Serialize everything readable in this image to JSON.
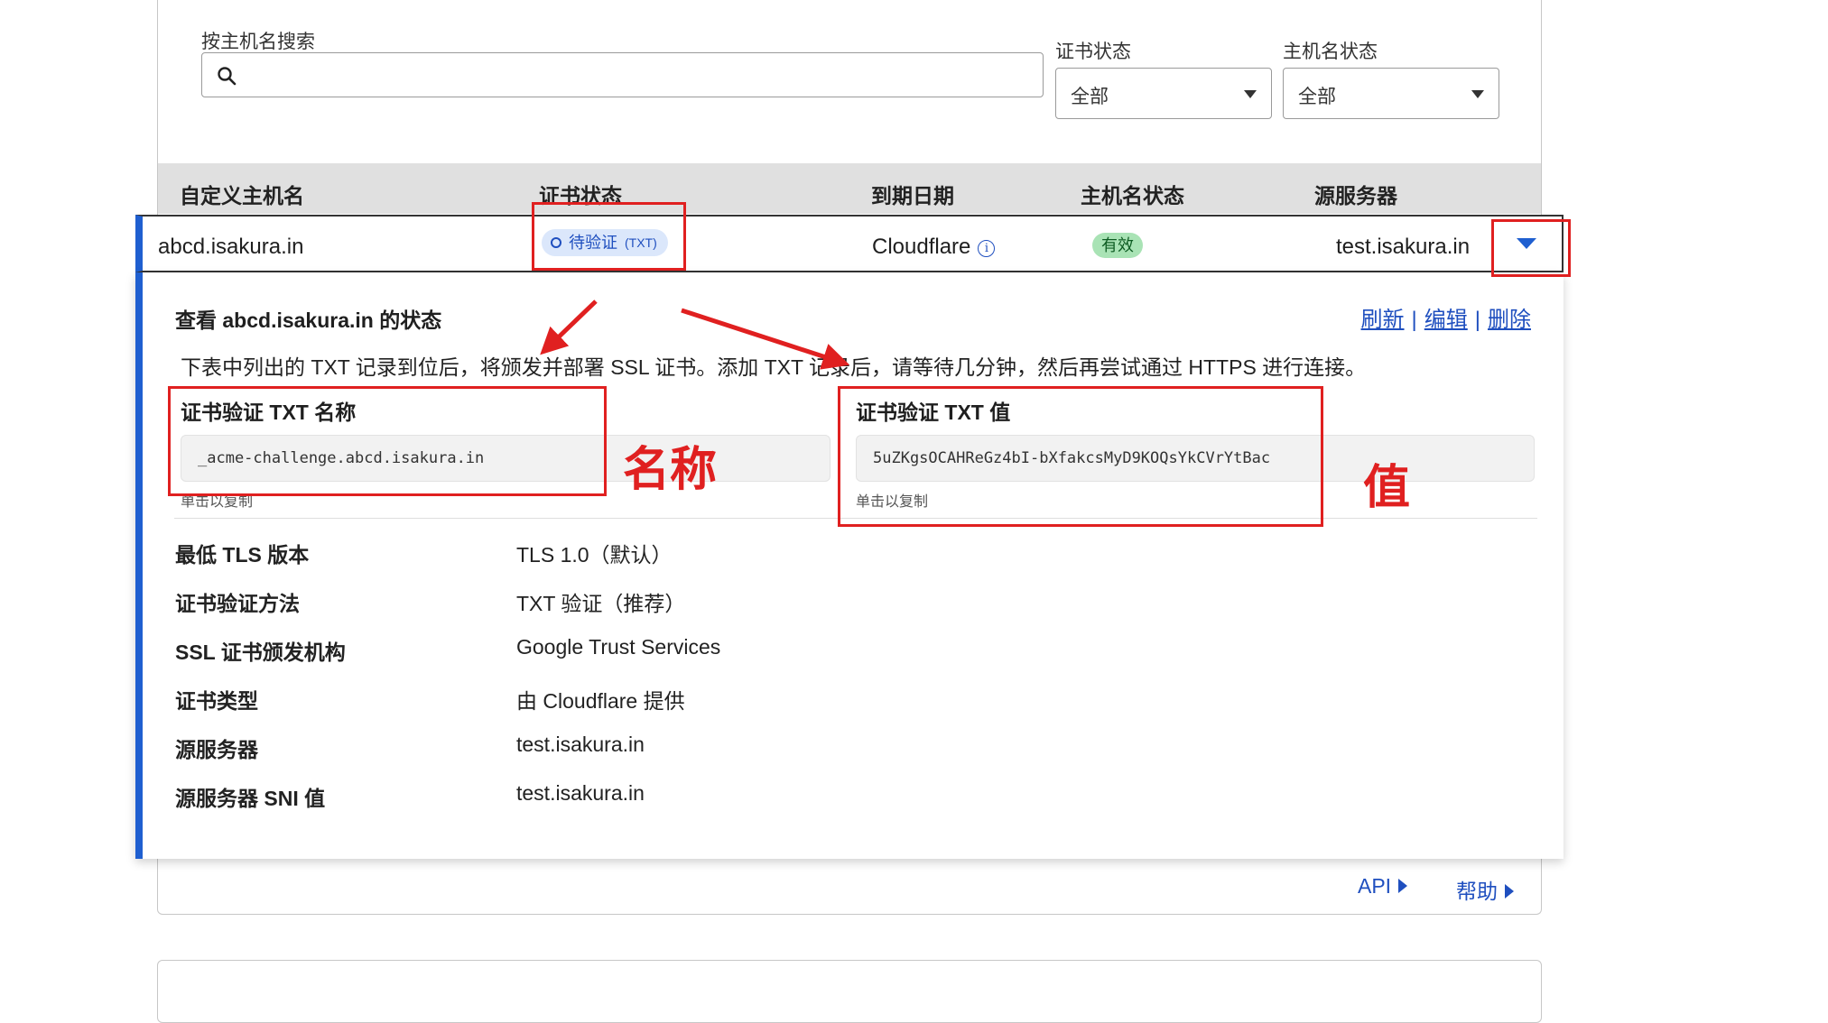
{
  "filters": {
    "search_label": "按主机名搜索",
    "search_value": "",
    "cert_status_label": "证书状态",
    "cert_status_value": "全部",
    "host_status_label": "主机名状态",
    "host_status_value": "全部"
  },
  "table": {
    "headers": [
      "自定义主机名",
      "证书状态",
      "到期日期",
      "主机名状态",
      "源服务器"
    ],
    "row": {
      "hostname": "abcd.isakura.in",
      "cert_status": "待验证",
      "cert_status_sub": "(TXT)",
      "expiry": "Cloudflare",
      "host_status": "有效",
      "origin": "test.isakura.in"
    }
  },
  "detail": {
    "title": "查看 abcd.isakura.in 的状态",
    "links": [
      "刷新",
      "编辑",
      "删除"
    ],
    "description": "下表中列出的 TXT 记录到位后，将颁发并部署 SSL 证书。添加 TXT 记录后，请等待几分钟，然后再尝试通过 HTTPS 进行连接。",
    "txt_name_label": "证书验证 TXT 名称",
    "txt_name_value": "_acme-challenge.abcd.isakura.in",
    "txt_value_label": "证书验证 TXT 值",
    "txt_value_value": "5uZKgsOCAHReGz4bI-bXfakcsMyD9KOQsYkCVrYtBac",
    "copy_hint": "单击以复制",
    "properties": [
      {
        "key": "最低 TLS 版本",
        "value": "TLS 1.0（默认）"
      },
      {
        "key": "证书验证方法",
        "value": "TXT 验证（推荐）"
      },
      {
        "key": "SSL 证书颁发机构",
        "value": "Google Trust Services"
      },
      {
        "key": "证书类型",
        "value": "由 Cloudflare 提供"
      },
      {
        "key": "源服务器",
        "value": "test.isakura.in"
      },
      {
        "key": "源服务器 SNI 值",
        "value": "test.isakura.in"
      }
    ]
  },
  "footer": {
    "api_label": "API",
    "help_label": "帮助"
  },
  "annotations": {
    "name_label": "名称",
    "value_label": "值"
  },
  "colors": {
    "accent": "#1f5fd0",
    "annotation": "#e02020",
    "header_bg": "#e0e0e0"
  },
  "icons": [
    "search-icon",
    "clock-icon",
    "info-icon",
    "chevron-down-icon",
    "caret-right-icon"
  ]
}
